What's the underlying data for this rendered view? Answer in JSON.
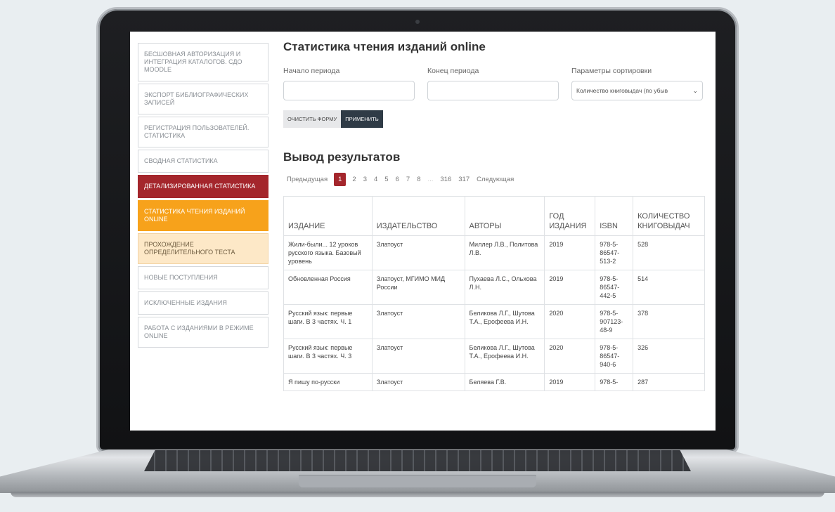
{
  "sidebar": {
    "items": [
      {
        "label": "Бесшовная авторизация и интеграция каталогов. СДО Moodle",
        "state": "normal"
      },
      {
        "label": "Экспорт библиографических записей",
        "state": "normal"
      },
      {
        "label": "Регистрация пользователей. Статистика",
        "state": "normal"
      },
      {
        "label": "Сводная статистика",
        "state": "normal"
      },
      {
        "label": "Детализированная статистика",
        "state": "active-dark"
      },
      {
        "label": "Статистика чтения изданий online",
        "state": "active-orange"
      },
      {
        "label": "Прохождение определительного теста",
        "state": "light-orange"
      },
      {
        "label": "Новые поступления",
        "state": "normal"
      },
      {
        "label": "Исключенные издания",
        "state": "normal"
      },
      {
        "label": "Работа с изданиями в режиме online",
        "state": "normal"
      }
    ]
  },
  "main": {
    "title": "Статистика чтения изданий online",
    "filters": {
      "start_label": "Начало периода",
      "start_value": "",
      "end_label": "Конец периода",
      "end_value": "",
      "sort_label": "Параметры сортировки",
      "sort_value": "Количество книговыдач (по убыв"
    },
    "buttons": {
      "clear": "Очистить форму",
      "apply": "Применить"
    },
    "results_title": "Вывод результатов",
    "pager": {
      "prev": "Предыдущая",
      "pages": [
        "1",
        "2",
        "3",
        "4",
        "5",
        "6",
        "7",
        "8",
        "...",
        "316",
        "317"
      ],
      "active": "1",
      "next": "Следующая"
    },
    "table": {
      "headers": [
        "Издание",
        "Издательство",
        "Авторы",
        "Год издания",
        "ISBN",
        "Количество книговыдач"
      ],
      "rows": [
        [
          "Жили-были... 12 уроков русского языка. Базовый уровень",
          "Златоуст",
          "Миллер Л.В., Политова Л.В.",
          "2019",
          "978-5-86547-513-2",
          "528"
        ],
        [
          "Обновленная Россия",
          "Златоуст, МГИМО МИД России",
          "Пухаева Л.С., Ольхова Л.Н.",
          "2019",
          "978-5-86547-442-5",
          "514"
        ],
        [
          "Русский язык: первые шаги. В 3 частях. Ч. 1",
          "Златоуст",
          "Беликова Л.Г., Шутова Т.А., Ерофеева И.Н.",
          "2020",
          "978-5-907123-48-9",
          "378"
        ],
        [
          "Русский язык: первые шаги. В 3 частях. Ч. 3",
          "Златоуст",
          "Беликова Л.Г., Шутова Т.А., Ерофеева И.Н.",
          "2020",
          "978-5-86547-940-6",
          "326"
        ],
        [
          "Я пишу по-русски",
          "Златоуст",
          "Беляева Г.В.",
          "2019",
          "978-5-",
          "287"
        ]
      ]
    }
  },
  "colors": {
    "accent_dark": "#a4262c",
    "accent_orange": "#f7a21b",
    "button_dark": "#2f3b46"
  }
}
